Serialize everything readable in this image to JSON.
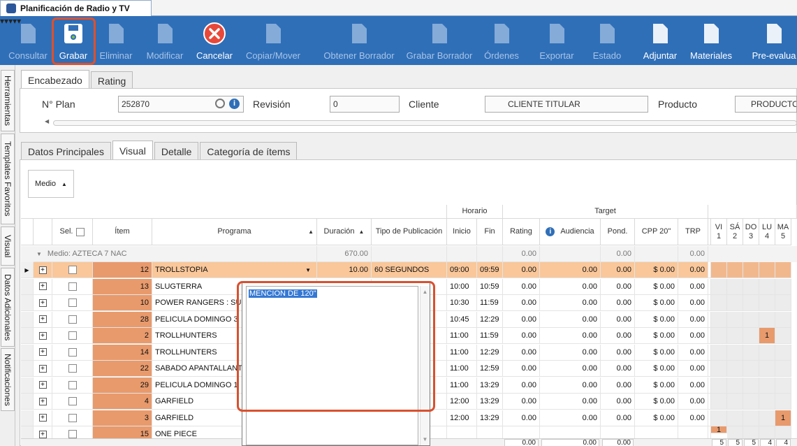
{
  "window": {
    "title": "Planificación de Radio y TV"
  },
  "toolbar": {
    "items": [
      {
        "label": "Consultar",
        "enabled": false,
        "icon": "document-question-icon"
      },
      {
        "label": "Grabar",
        "enabled": true,
        "icon": "floppy-disk-icon"
      },
      {
        "label": "Eliminar",
        "enabled": false,
        "icon": "document-delete-icon"
      },
      {
        "label": "Modificar",
        "enabled": false,
        "icon": "document-edit-icon"
      },
      {
        "label": "Cancelar",
        "enabled": true,
        "icon": "cancel-icon"
      },
      {
        "label": "Copiar/Mover",
        "enabled": false,
        "icon": "copy-icon"
      },
      {
        "label": "Obtener Borrador",
        "enabled": false,
        "icon": "folder-open-icon"
      },
      {
        "label": "Grabar Borrador",
        "enabled": false,
        "icon": "draft-save-icon"
      },
      {
        "label": "Órdenes",
        "enabled": false,
        "icon": "orders-icon"
      },
      {
        "label": "Exportar",
        "enabled": false,
        "icon": "export-icon"
      },
      {
        "label": "Estado",
        "enabled": false,
        "icon": "status-icon"
      },
      {
        "label": "Adjuntar",
        "enabled": true,
        "icon": "attach-icon"
      },
      {
        "label": "Materiales",
        "enabled": true,
        "icon": "materials-icon"
      },
      {
        "label": "Pre-evalua",
        "enabled": true,
        "icon": "pre-evaluate-icon"
      }
    ]
  },
  "sidebar": {
    "tabs": [
      "Herramientas",
      "Templates Favoritos",
      "Visual",
      "Datos Adicionales",
      "Notificaciones"
    ]
  },
  "top_tabs": [
    "Encabezado",
    "Rating"
  ],
  "header": {
    "plan_label": "N° Plan",
    "plan_value": "252870",
    "revision_label": "Revisión",
    "revision_value": "0",
    "cliente_label": "Cliente",
    "cliente_value": "CLIENTE TITULAR",
    "producto_label": "Producto",
    "producto_value": "PRODUCTO"
  },
  "sub_tabs": [
    "Datos Principales",
    "Visual",
    "Detalle",
    "Categoría de ítems"
  ],
  "group_button": "Medio",
  "grid": {
    "group_headers": {
      "horario": "Horario",
      "target": "Target"
    },
    "columns": {
      "sel": "Sel.",
      "item": "Ítem",
      "programa": "Programa",
      "duracion": "Duración",
      "tipo": "Tipo de Publicación",
      "inicio": "Inicio",
      "fin": "Fin",
      "rating": "Rating",
      "audiencia": "Audiencia",
      "pond": "Pond.",
      "cpp": "CPP 20\"",
      "trp": "TRP"
    },
    "days": [
      {
        "d": "VI",
        "n": "1"
      },
      {
        "d": "SÁ",
        "n": "2"
      },
      {
        "d": "DO",
        "n": "3"
      },
      {
        "d": "LU",
        "n": "4"
      },
      {
        "d": "MA",
        "n": "5"
      }
    ],
    "group_row": {
      "label": "Medio: AZTECA 7 NAC",
      "duracion": "670.00",
      "rating": "0.00",
      "pond": "0.00",
      "trp": "0.00"
    },
    "rows": [
      {
        "item": "12",
        "programa": "TROLLSTOPIA",
        "duracion": "10.00",
        "tipo": "60 SEGUNDOS",
        "inicio": "09:00",
        "fin": "09:59",
        "rating": "0.00",
        "audiencia": "0.00",
        "pond": "0.00",
        "cpp": "$ 0.00",
        "trp": "0.00"
      },
      {
        "item": "13",
        "programa": "SLUGTERRA",
        "duracion": "",
        "tipo": "",
        "inicio": "10:00",
        "fin": "10:59",
        "rating": "0.00",
        "audiencia": "0.00",
        "pond": "0.00",
        "cpp": "$ 0.00",
        "trp": "0.00"
      },
      {
        "item": "10",
        "programa": "POWER RANGERS : SUP",
        "duracion": "",
        "tipo": "",
        "inicio": "10:30",
        "fin": "11:59",
        "rating": "0.00",
        "audiencia": "0.00",
        "pond": "0.00",
        "cpp": "$ 0.00",
        "trp": "0.00"
      },
      {
        "item": "28",
        "programa": "PELICULA DOMINGO 3",
        "duracion": "",
        "tipo": "",
        "inicio": "10:45",
        "fin": "12:29",
        "rating": "0.00",
        "audiencia": "0.00",
        "pond": "0.00",
        "cpp": "$ 0.00",
        "trp": "0.00"
      },
      {
        "item": "2",
        "programa": "TROLLHUNTERS",
        "duracion": "",
        "tipo": "",
        "inicio": "11:00",
        "fin": "11:59",
        "rating": "0.00",
        "audiencia": "0.00",
        "pond": "0.00",
        "cpp": "$ 0.00",
        "trp": "0.00"
      },
      {
        "item": "14",
        "programa": "TROLLHUNTERS",
        "duracion": "",
        "tipo": "",
        "inicio": "11:00",
        "fin": "12:29",
        "rating": "0.00",
        "audiencia": "0.00",
        "pond": "0.00",
        "cpp": "$ 0.00",
        "trp": "0.00"
      },
      {
        "item": "22",
        "programa": "SABADO APANTALLANT",
        "duracion": "",
        "tipo": "",
        "inicio": "11:00",
        "fin": "12:59",
        "rating": "0.00",
        "audiencia": "0.00",
        "pond": "0.00",
        "cpp": "$ 0.00",
        "trp": "0.00"
      },
      {
        "item": "29",
        "programa": "PELICULA DOMINGO 1",
        "duracion": "",
        "tipo": "",
        "inicio": "11:00",
        "fin": "13:29",
        "rating": "0.00",
        "audiencia": "0.00",
        "pond": "0.00",
        "cpp": "$ 0.00",
        "trp": "0.00"
      },
      {
        "item": "4",
        "programa": "GARFIELD",
        "duracion": "",
        "tipo": "",
        "inicio": "12:00",
        "fin": "13:29",
        "rating": "0.00",
        "audiencia": "0.00",
        "pond": "0.00",
        "cpp": "$ 0.00",
        "trp": "0.00"
      },
      {
        "item": "3",
        "programa": "GARFIELD",
        "duracion": "",
        "tipo": "",
        "inicio": "12:00",
        "fin": "13:29",
        "rating": "0.00",
        "audiencia": "0.00",
        "pond": "0.00",
        "cpp": "$ 0.00",
        "trp": "0.00"
      },
      {
        "item": "15",
        "programa": "ONE PIECE",
        "duracion": "",
        "tipo": "",
        "inicio": "",
        "fin": "",
        "rating": "",
        "audiencia": "",
        "pond": "",
        "cpp": "",
        "trp": ""
      }
    ],
    "day_marks": [
      {
        "row": 4,
        "day": 3,
        "value": "1"
      },
      {
        "row": 9,
        "day": 4,
        "value": "1"
      },
      {
        "row": 10,
        "day": 0,
        "value": "1"
      }
    ],
    "footer": {
      "rating": "0.00",
      "audiencia": "0.00",
      "pond": "0.00",
      "days": [
        "5",
        "5",
        "5",
        "4",
        "4"
      ]
    }
  },
  "popup": {
    "selected_text": "MENCION DE 120\""
  }
}
